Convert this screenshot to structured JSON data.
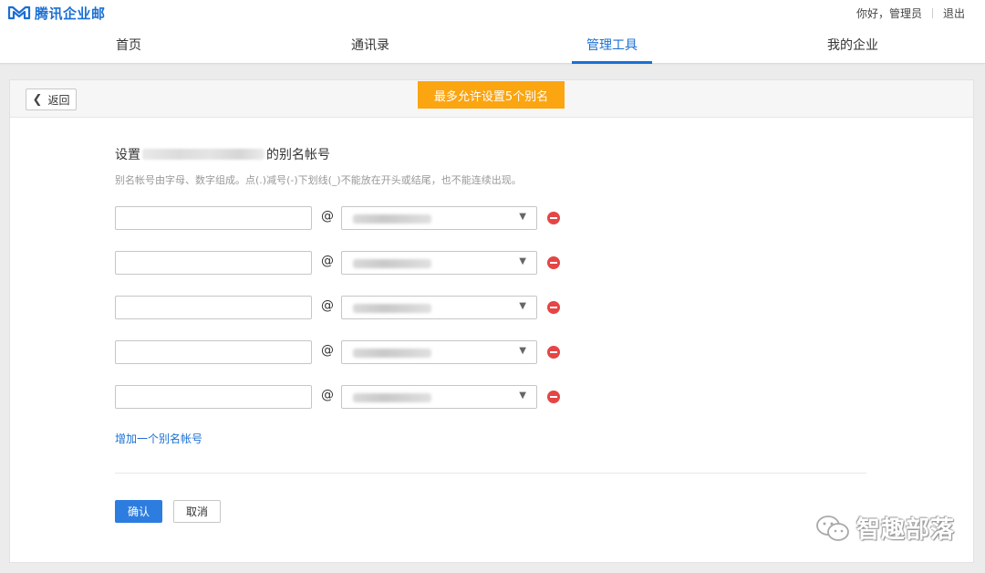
{
  "app": {
    "logo_icon": "envelope-m-logo",
    "logo_text": "腾讯企业邮",
    "brand_color": "#1a6fd4"
  },
  "user": {
    "greeting": "你好，管理员",
    "logout": "退出"
  },
  "nav": {
    "items": [
      {
        "label": "首页",
        "active": false
      },
      {
        "label": "通讯录",
        "active": false
      },
      {
        "label": "管理工具",
        "active": true
      },
      {
        "label": "我的企业",
        "active": false
      }
    ]
  },
  "toolbar": {
    "back_label": "返回",
    "back_icon": "chevron-left-icon"
  },
  "notice": {
    "text": "最多允许设置5个别名",
    "color": "#fba511"
  },
  "form": {
    "title_prefix": "设置",
    "title_suffix": "的别名帐号",
    "hint": "别名帐号由字母、数字组成。点(.)减号(-)下划线(_)不能放在开头或结尾，也不能连续出现。",
    "at_symbol": "@",
    "rows": [
      {
        "alias": "",
        "remove_icon": "minus-circle-icon"
      },
      {
        "alias": "",
        "remove_icon": "minus-circle-icon"
      },
      {
        "alias": "",
        "remove_icon": "minus-circle-icon"
      },
      {
        "alias": "",
        "remove_icon": "minus-circle-icon"
      },
      {
        "alias": "",
        "remove_icon": "minus-circle-icon"
      }
    ],
    "add_label": "增加一个别名帐号",
    "confirm_label": "确认",
    "cancel_label": "取消",
    "remove_color": "#e54545"
  },
  "watermark": {
    "icon": "wechat-icon",
    "text": "智趣部落"
  }
}
